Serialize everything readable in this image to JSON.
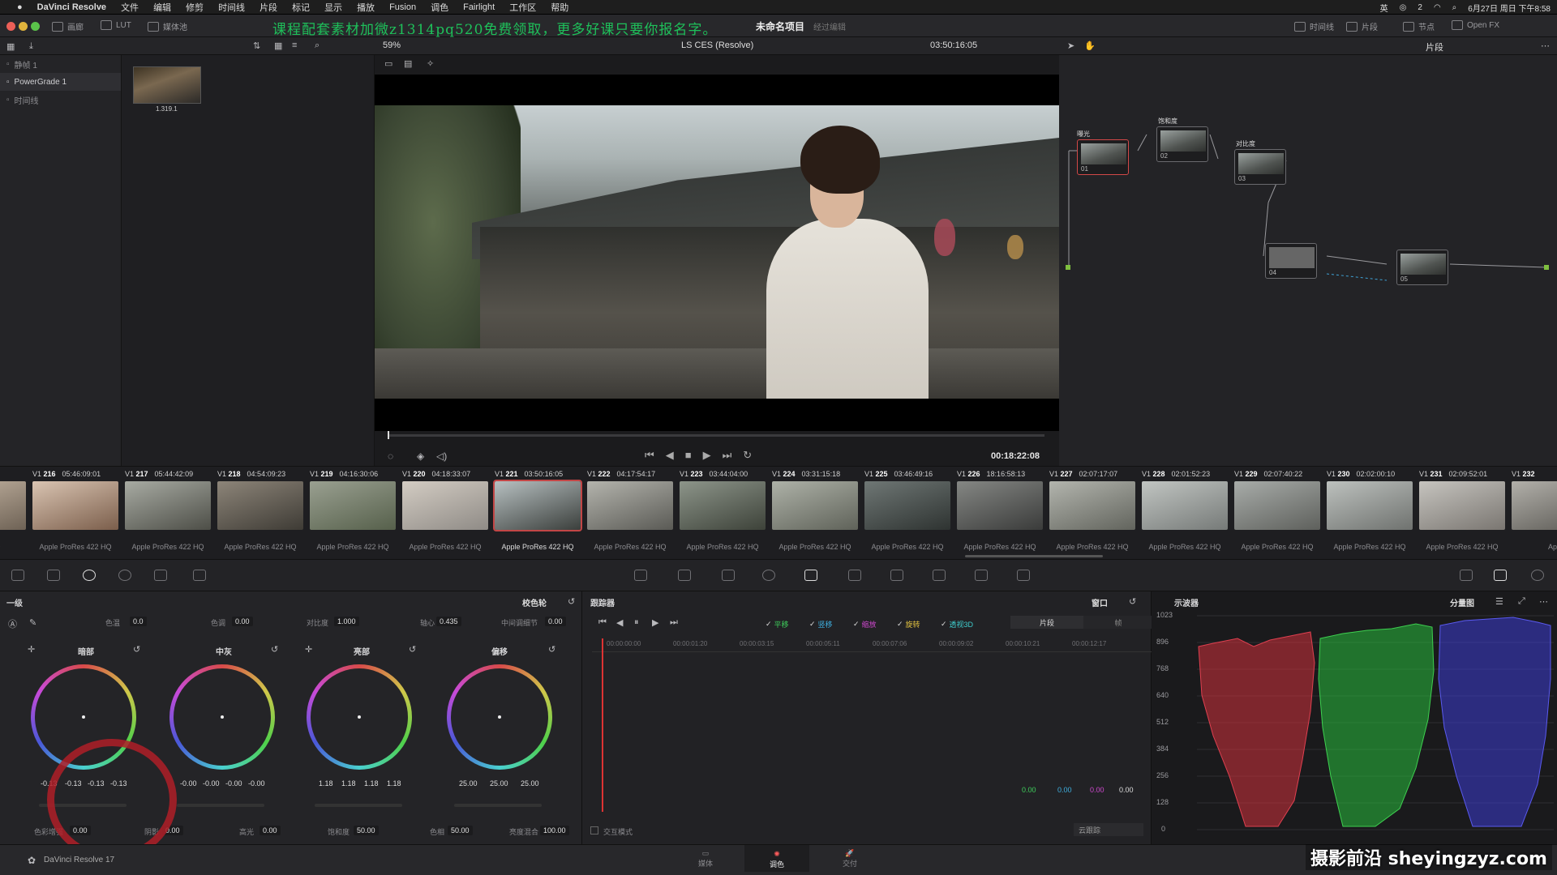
{
  "menubar": {
    "app": "DaVinci Resolve",
    "items": [
      "文件",
      "编辑",
      "修剪",
      "时间线",
      "片段",
      "标记",
      "显示",
      "播放",
      "Fusion",
      "调色",
      "Fairlight",
      "工作区",
      "帮助"
    ],
    "right_ime": "英",
    "right_wechat": "2",
    "datetime": "6月27日 周日 下午8:58"
  },
  "topbar": {
    "gallery_label": "画廊",
    "lut_label": "LUT",
    "media_label": "媒体池",
    "overlay_text": "课程配套素材加微z1314pq520免费领取，更多好课只要你报名字。",
    "project_title": "未命名项目",
    "project_status": "经过编辑",
    "timeline_label": "时间线",
    "clip_label": "片段",
    "nodes_label": "节点",
    "openfx_label": "Open FX"
  },
  "viewerbar": {
    "zoom": "59%",
    "color_space": "LS CES (Resolve)",
    "timecode": "03:50:16:05",
    "right_mode": "片段"
  },
  "gallery": {
    "items": [
      "静帧 1",
      "PowerGrade 1",
      "时间线"
    ],
    "still_label": "1.319.1"
  },
  "playback": {
    "timecode": "00:18:22:08"
  },
  "nodes": [
    {
      "id": "01",
      "title": "曝光",
      "selected": true
    },
    {
      "id": "02",
      "title": "饱和度",
      "selected": false
    },
    {
      "id": "03",
      "title": "对比度",
      "selected": false
    },
    {
      "id": "04",
      "title": "",
      "selected": false
    },
    {
      "id": "05",
      "title": "",
      "selected": false
    }
  ],
  "clips": [
    {
      "num": "",
      "tc": "42:08:04",
      "codec": "es 422 HQ",
      "colors": [
        "#c8b8a6",
        "#6e6255"
      ]
    },
    {
      "num": "216",
      "tc": "05:46:09:01",
      "codec": "Apple ProRes 422 HQ",
      "colors": [
        "#d9c4b2",
        "#7b5e4b"
      ]
    },
    {
      "num": "217",
      "tc": "05:44:42:09",
      "codec": "Apple ProRes 422 HQ",
      "colors": [
        "#a8aba3",
        "#4d4e47"
      ]
    },
    {
      "num": "218",
      "tc": "04:54:09:23",
      "codec": "Apple ProRes 422 HQ",
      "colors": [
        "#8d8579",
        "#3e3b35"
      ]
    },
    {
      "num": "219",
      "tc": "04:16:30:06",
      "codec": "Apple ProRes 422 HQ",
      "colors": [
        "#9aa091",
        "#56604b"
      ]
    },
    {
      "num": "220",
      "tc": "04:18:33:07",
      "codec": "Apple ProRes 422 HQ",
      "colors": [
        "#d3ccc3",
        "#8f8b86"
      ]
    },
    {
      "num": "221",
      "tc": "03:50:16:05",
      "codec": "Apple ProRes 422 HQ",
      "colors": [
        "#b7c0c1",
        "#3b3f3c"
      ]
    },
    {
      "num": "222",
      "tc": "04:17:54:17",
      "codec": "Apple ProRes 422 HQ",
      "colors": [
        "#b4b4ad",
        "#5a5a55"
      ]
    },
    {
      "num": "223",
      "tc": "03:44:04:00",
      "codec": "Apple ProRes 422 HQ",
      "colors": [
        "#8d958a",
        "#3d4239"
      ]
    },
    {
      "num": "224",
      "tc": "03:31:15:18",
      "codec": "Apple ProRes 422 HQ",
      "colors": [
        "#aeb2a8",
        "#5f6259"
      ]
    },
    {
      "num": "225",
      "tc": "03:46:49:16",
      "codec": "Apple ProRes 422 HQ",
      "colors": [
        "#6f7775",
        "#2e3331"
      ]
    },
    {
      "num": "226",
      "tc": "18:16:58:13",
      "codec": "Apple ProRes 422 HQ",
      "colors": [
        "#858784",
        "#3a3b3a"
      ]
    },
    {
      "num": "227",
      "tc": "02:07:17:07",
      "codec": "Apple ProRes 422 HQ",
      "colors": [
        "#b3b5ae",
        "#62645d"
      ]
    },
    {
      "num": "228",
      "tc": "02:01:52:23",
      "codec": "Apple ProRes 422 HQ",
      "colors": [
        "#c1c5c2",
        "#767a78"
      ]
    },
    {
      "num": "229",
      "tc": "02:07:40:22",
      "codec": "Apple ProRes 422 HQ",
      "colors": [
        "#a8aca9",
        "#5e605c"
      ]
    },
    {
      "num": "230",
      "tc": "02:02:00:10",
      "codec": "Apple ProRes 422 HQ",
      "colors": [
        "#bdc1be",
        "#6f726f"
      ]
    },
    {
      "num": "231",
      "tc": "02:09:52:01",
      "codec": "Apple ProRes 422 HQ",
      "colors": [
        "#c6c4bf",
        "#7a7671"
      ]
    },
    {
      "num": "232",
      "tc": "",
      "codec": "App",
      "colors": [
        "#b2b0aa",
        "#5a5853"
      ]
    }
  ],
  "primaries": {
    "title": "一级",
    "mode": "校色轮",
    "temp_label": "色温",
    "temp": "0.0",
    "tint_label": "色调",
    "tint": "0.00",
    "contrast_label": "对比度",
    "contrast": "1.000",
    "pivot_label": "轴心",
    "pivot": "0.435",
    "middetail_label": "中间调细节",
    "middetail": "0.00",
    "wheels": [
      {
        "name": "暗部",
        "vals": [
          "-0.13",
          "-0.13",
          "-0.13",
          "-0.13"
        ]
      },
      {
        "name": "中灰",
        "vals": [
          "-0.00",
          "-0.00",
          "-0.00",
          "-0.00"
        ]
      },
      {
        "name": "亮部",
        "vals": [
          "1.18",
          "1.18",
          "1.18",
          "1.18"
        ]
      },
      {
        "name": "偏移",
        "vals": [
          "25.00",
          "25.00",
          "25.00"
        ]
      }
    ],
    "colorboost_label": "色彩增强",
    "colorboost": "0.00",
    "shadows_label": "阴影",
    "shadows": "0.00",
    "highlights_label": "高光",
    "highlights": "0.00",
    "saturation_label": "饱和度",
    "saturation": "50.00",
    "hue_label": "色相",
    "hue": "50.00",
    "lummix_label": "亮度混合",
    "lummix": "100.00"
  },
  "tracker": {
    "title": "跟踪器",
    "window_label": "窗口",
    "checks": [
      {
        "label": "平移",
        "color": "#3fcf5c"
      },
      {
        "label": "竖移",
        "color": "#3fb0e0"
      },
      {
        "label": "缩放",
        "color": "#d048d0"
      },
      {
        "label": "旋转",
        "color": "#e0c040"
      },
      {
        "label": "透视3D",
        "color": "#3fcfcf"
      }
    ],
    "tab_clip": "片段",
    "tab_frame": "帧",
    "ruler": [
      "00:00:00:00",
      "00:00:01:20",
      "00:00:03:15",
      "00:00:05:11",
      "00:00:07:06",
      "00:00:09:02",
      "00:00:10:21",
      "00:00:12:17"
    ],
    "values": [
      "0.00",
      "0.00",
      "0.00",
      "0.00"
    ],
    "interactive_label": "交互模式",
    "cloud_label": "云跟踪"
  },
  "scope": {
    "title": "示波器",
    "mode": "分量图",
    "ticks": [
      "1023",
      "896",
      "768",
      "640",
      "512",
      "384",
      "256",
      "128",
      "0"
    ]
  },
  "pagebar": {
    "brand": "DaVinci Resolve 17",
    "tabs": [
      "媒体",
      "调色",
      "交付"
    ],
    "active": "调色",
    "watermark": "摄影前沿 sheyingzyz.com"
  }
}
